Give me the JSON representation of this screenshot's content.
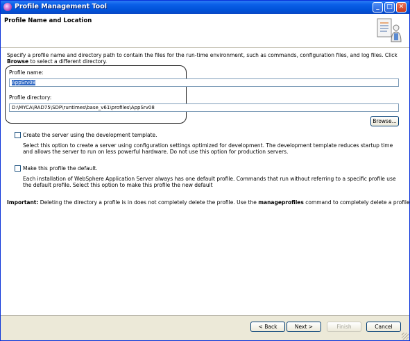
{
  "window": {
    "title": "Profile Management Tool",
    "minimize_glyph": "_",
    "maximize_glyph": "□",
    "close_glyph": "✕"
  },
  "header": {
    "page_title": "Profile Name and Location",
    "icon": "profile-wizard-icon"
  },
  "description": {
    "text_before": "Specify a profile name and directory path to contain the files for the run-time environment, such as commands, configuration files, and log files. Click ",
    "bold_word": "Browse",
    "text_after": " to select a different directory."
  },
  "profile_name": {
    "label": "Profile name:",
    "value": "AppSrv08"
  },
  "profile_directory": {
    "label": "Profile directory:",
    "value": "D:\\MYCA\\RAD75\\SDP\\runtimes\\base_v61\\profiles\\AppSrv08"
  },
  "browse_button": "Browse...",
  "dev_template": {
    "checked": false,
    "label": "Create the server using the development template.",
    "description": "Select this option to create a server using configuration settings optimized for development. The development template reduces startup time and allows the server to run on less powerful hardware. Do not use this option for production servers."
  },
  "default_profile": {
    "checked": false,
    "label": "Make this profile the default.",
    "description": "Each installation of WebSphere Application Server always has one default profile. Commands that run without referring to a specific profile use the default profile. Select this option to make this profile the new default"
  },
  "important": {
    "prefix": "Important:",
    "text_before": " Deleting the directory a profile is in does not completely delete the profile. Use the ",
    "command": "manageprofiles",
    "text_after": " command to completely delete a profile."
  },
  "footer": {
    "back": "< Back",
    "next": "Next >",
    "finish": "Finish",
    "cancel": "Cancel"
  },
  "colors": {
    "titlebar": "#0a5fe8",
    "selection": "#316ac5",
    "dialog_bg": "#ece9d8"
  }
}
